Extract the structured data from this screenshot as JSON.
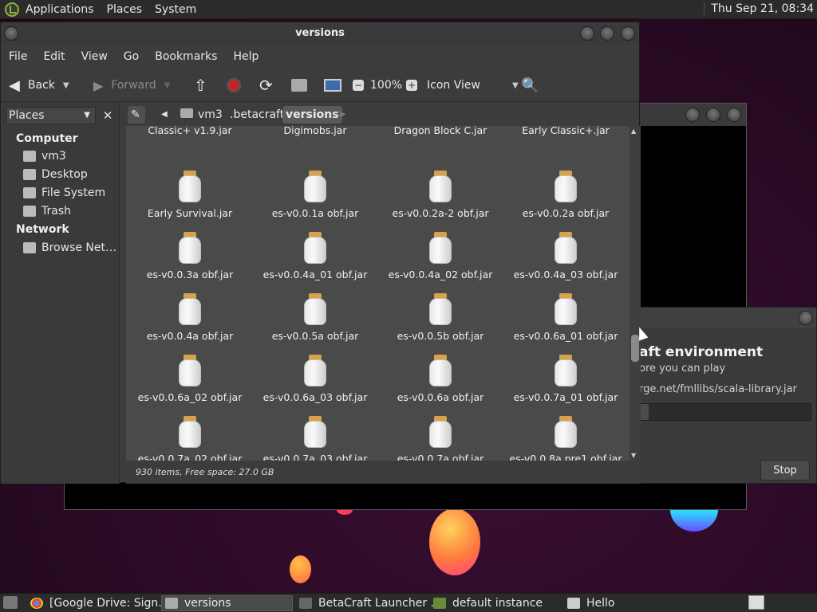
{
  "top_panel": {
    "menus": [
      "Applications",
      "Places",
      "System"
    ],
    "clock": "Thu Sep 21, 08:34"
  },
  "launcher": {
    "heading": "aft environment",
    "subtext": "ore you can play",
    "url": "rge.net/fmllibs/scala-library.jar",
    "stop_label": "Stop",
    "progress": 0.05
  },
  "file_manager": {
    "title": "versions",
    "menubar": [
      "File",
      "Edit",
      "View",
      "Go",
      "Bookmarks",
      "Help"
    ],
    "toolbar": {
      "back_label": "Back",
      "forward_label": "Forward",
      "zoom": "100%",
      "view_mode": "Icon View"
    },
    "side_pane": {
      "combo_label": "Places",
      "computer_heading": "Computer",
      "computer_items": [
        "vm3",
        "Desktop",
        "File System",
        "Trash"
      ],
      "network_heading": "Network",
      "network_items": [
        "Browse Net…"
      ]
    },
    "path": [
      "vm3",
      ".betacraft",
      "versions"
    ],
    "files_partial_top": [
      "Classic+ v1.9.jar",
      "Digimobs.jar",
      "Dragon Block C.jar",
      "Early Classic+.jar"
    ],
    "files": [
      "Early Survival.jar",
      "es-v0.0.1a obf.jar",
      "es-v0.0.2a-2 obf.jar",
      "es-v0.0.2a obf.jar",
      "es-v0.0.3a obf.jar",
      "es-v0.0.4a_01 obf.jar",
      "es-v0.0.4a_02 obf.jar",
      "es-v0.0.4a_03 obf.jar",
      "es-v0.0.4a obf.jar",
      "es-v0.0.5a obf.jar",
      "es-v0.0.5b obf.jar",
      "es-v0.0.6a_01 obf.jar",
      "es-v0.0.6a_02 obf.jar",
      "es-v0.0.6a_03 obf.jar",
      "es-v0.0.6a obf.jar",
      "es-v0.0.7a_01 obf.jar",
      "es-v0.0.7a_02 obf.jar",
      "es-v0.0.7a_03 obf.jar",
      "es-v0.0.7a obf.jar",
      "es-v0.0.8a pre1 obf.jar"
    ],
    "status": "930 items, Free space: 27.0 GB"
  },
  "taskbar": {
    "tasks": [
      "[Google Drive: Sign…",
      "versions",
      "BetaCraft Launcher …",
      "default instance",
      "Hello"
    ]
  }
}
